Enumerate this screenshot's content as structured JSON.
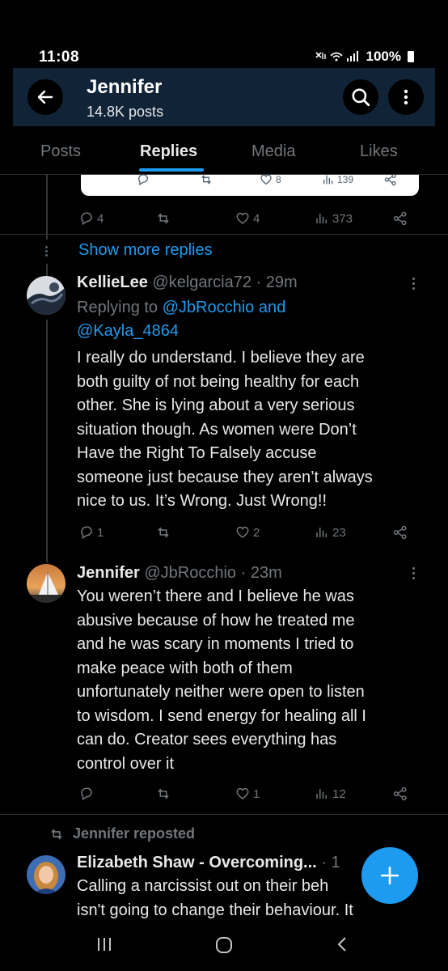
{
  "status_bar": {
    "time": "11:08",
    "battery": "100%"
  },
  "header": {
    "title": "Jennifer",
    "subtitle": "14.8K posts"
  },
  "tabs": [
    {
      "label": "Posts"
    },
    {
      "label": "Replies",
      "active": true
    },
    {
      "label": "Media"
    },
    {
      "label": "Likes"
    }
  ],
  "quote_card": {
    "likes": "8",
    "views": "139"
  },
  "prev_tweet_actions": {
    "replies": "4",
    "likes": "4",
    "views": "373"
  },
  "show_more": "Show more replies",
  "tweet1": {
    "name": "KellieLee",
    "handle": "@kelgarcia72",
    "time": "· 29m",
    "replying_prefix": "Replying to",
    "replying_users": "@JbRocchio and",
    "replying_user2": "@Kayla_4864",
    "text_lines": [
      "I really do understand. I believe they are",
      "both guilty of not being healthy for each",
      "other. She is lying about a very serious",
      "situation though. As women were Don’t",
      "Have the Right To Falsely accuse",
      "someone just because they aren’t always",
      "nice to us. It’s Wrong. Just Wrong!!"
    ],
    "replies": "1",
    "likes": "2",
    "views": "23"
  },
  "tweet2": {
    "name": "Jennifer",
    "handle": "@JbRocchio",
    "time": "· 23m",
    "text_lines": [
      "You weren’t there and I believe he was",
      "abusive because of how he treated me",
      "and he was scary in moments I tried to",
      "make peace with both of them",
      "unfortunately neither were open to listen",
      "to wisdom. I send energy for healing all I",
      "can do. Creator sees everything has",
      "control over it"
    ],
    "likes": "1",
    "views": "12"
  },
  "repost_label": "Jennifer reposted",
  "tweet3": {
    "name": "Elizabeth Shaw - Overcoming...",
    "time": "· 1",
    "text_lines": [
      "Calling a narcissist out on their beh",
      "isn't going to change their behaviour. It"
    ]
  },
  "colors": {
    "accent": "#1d9bf0",
    "header_bg": "#112337",
    "muted": "#71767b"
  }
}
